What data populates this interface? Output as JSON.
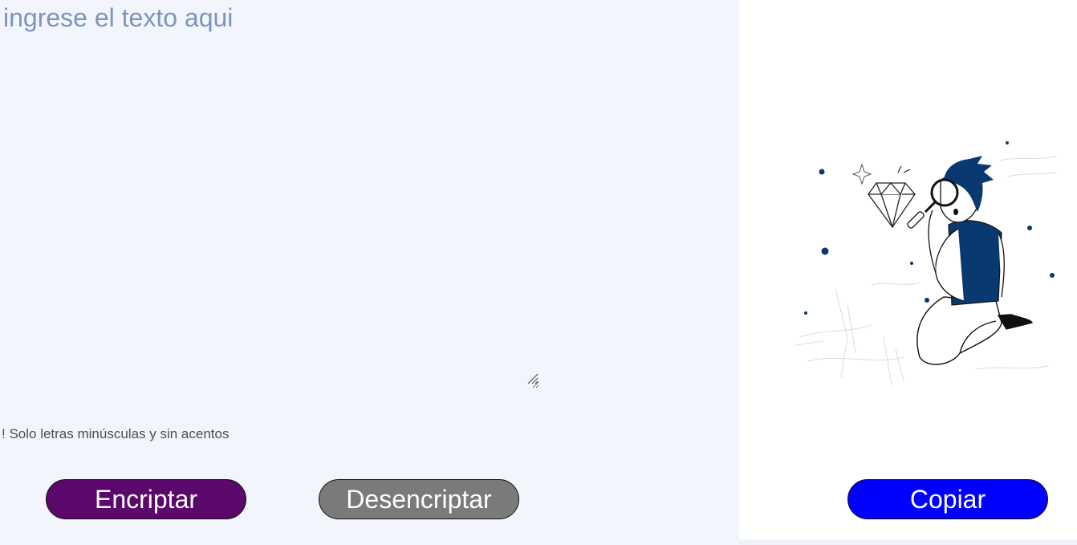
{
  "input": {
    "placeholder": "ingrese el texto aqui",
    "value": ""
  },
  "warning": {
    "text": "! Solo letras minúsculas y sin acentos"
  },
  "buttons": {
    "encrypt_label": "Encriptar",
    "decrypt_label": "Desencriptar",
    "copy_label": "Copiar"
  },
  "illustration": {
    "icon": "person-with-magnifying-glass-and-diamond-illustration"
  },
  "colors": {
    "page_bg": "#f3f5fc",
    "accent_dark_blue": "#0a3871",
    "encrypt_bg": "#5c076b",
    "decrypt_bg": "#7a7a7a",
    "copy_bg": "#0000ff",
    "placeholder": "#7d94bd"
  }
}
